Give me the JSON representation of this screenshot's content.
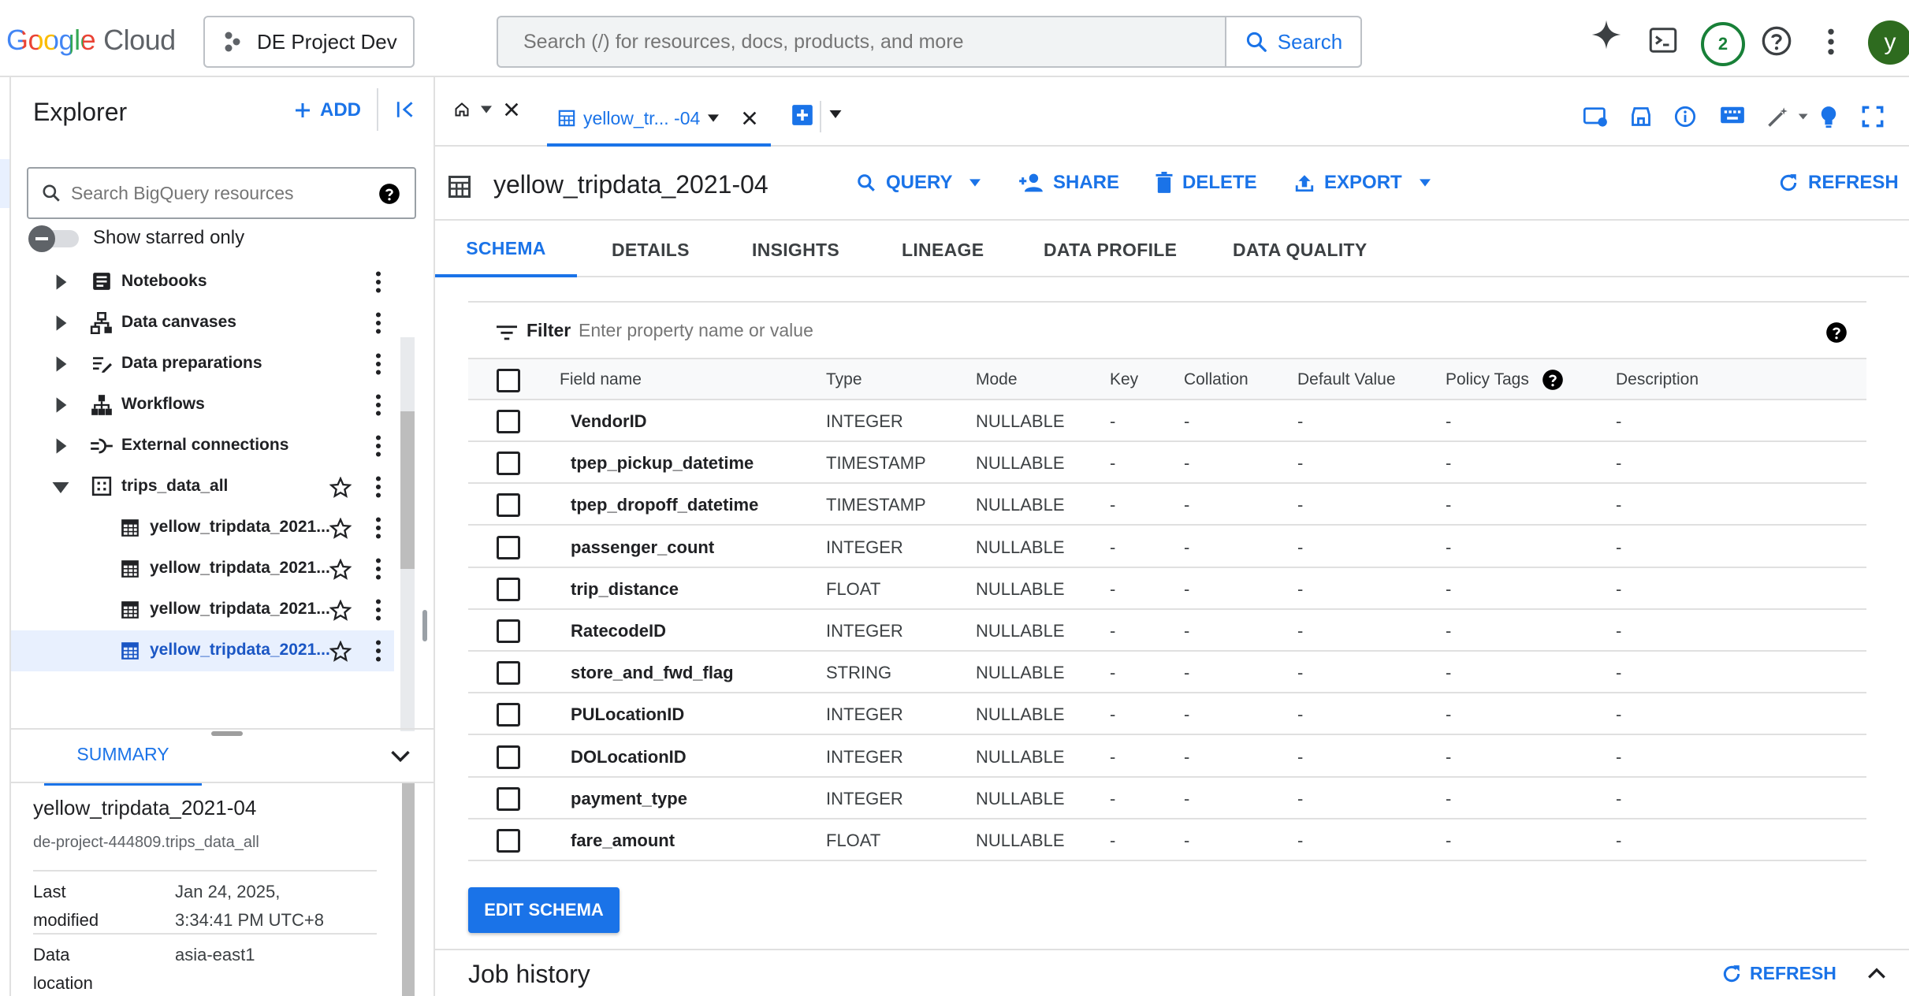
{
  "header": {
    "logo_google": "Google",
    "logo_cloud": "Cloud",
    "project": "DE Project Dev",
    "search_placeholder": "Search (/) for resources, docs, products, and more",
    "search_button": "Search",
    "notification_count": "2",
    "avatar_letter": "y"
  },
  "explorer": {
    "title": "Explorer",
    "add_label": "ADD",
    "search_placeholder": "Search BigQuery resources",
    "starred_label": "Show starred only",
    "items": [
      {
        "label": "Notebooks",
        "icon": "notebook-icon"
      },
      {
        "label": "Data canvases",
        "icon": "canvas-icon"
      },
      {
        "label": "Data preparations",
        "icon": "data-prep-icon"
      },
      {
        "label": "Workflows",
        "icon": "workflow-icon"
      },
      {
        "label": "External connections",
        "icon": "connection-icon"
      },
      {
        "label": "trips_data_all",
        "icon": "dataset-icon"
      },
      {
        "label": "yellow_tripdata_2021...",
        "icon": "table-icon"
      },
      {
        "label": "yellow_tripdata_2021...",
        "icon": "table-icon"
      },
      {
        "label": "yellow_tripdata_2021...",
        "icon": "table-icon"
      },
      {
        "label": "yellow_tripdata_2021...",
        "icon": "table-icon"
      }
    ],
    "summary": {
      "tab": "SUMMARY",
      "table_name": "yellow_tripdata_2021-04",
      "table_path": "de-project-444809.trips_data_all",
      "last_modified_key_1": "Last",
      "last_modified_key_2": "modified",
      "last_modified_value_1": "Jan 24, 2025,",
      "last_modified_value_2": "3:34:41 PM UTC+8",
      "data_location_key_1": "Data",
      "data_location_key_2": "location",
      "data_location_value": "asia-east1"
    }
  },
  "main": {
    "tab_label": "yellow_tr... -04",
    "table_title": "yellow_tripdata_2021-04",
    "actions": {
      "query": "QUERY",
      "share": "SHARE",
      "delete": "DELETE",
      "export": "EXPORT",
      "refresh": "REFRESH"
    },
    "subtabs": [
      "SCHEMA",
      "DETAILS",
      "INSIGHTS",
      "LINEAGE",
      "DATA PROFILE",
      "DATA QUALITY"
    ],
    "filter_label": "Filter",
    "filter_placeholder": "Enter property name or value",
    "columns": [
      "Field name",
      "Type",
      "Mode",
      "Key",
      "Collation",
      "Default Value",
      "Policy Tags",
      "Description"
    ],
    "rows": [
      [
        "VendorID",
        "INTEGER",
        "NULLABLE",
        "-",
        "-",
        "-",
        "-",
        "-"
      ],
      [
        "tpep_pickup_datetime",
        "TIMESTAMP",
        "NULLABLE",
        "-",
        "-",
        "-",
        "-",
        "-"
      ],
      [
        "tpep_dropoff_datetime",
        "TIMESTAMP",
        "NULLABLE",
        "-",
        "-",
        "-",
        "-",
        "-"
      ],
      [
        "passenger_count",
        "INTEGER",
        "NULLABLE",
        "-",
        "-",
        "-",
        "-",
        "-"
      ],
      [
        "trip_distance",
        "FLOAT",
        "NULLABLE",
        "-",
        "-",
        "-",
        "-",
        "-"
      ],
      [
        "RatecodeID",
        "INTEGER",
        "NULLABLE",
        "-",
        "-",
        "-",
        "-",
        "-"
      ],
      [
        "store_and_fwd_flag",
        "STRING",
        "NULLABLE",
        "-",
        "-",
        "-",
        "-",
        "-"
      ],
      [
        "PULocationID",
        "INTEGER",
        "NULLABLE",
        "-",
        "-",
        "-",
        "-",
        "-"
      ],
      [
        "DOLocationID",
        "INTEGER",
        "NULLABLE",
        "-",
        "-",
        "-",
        "-",
        "-"
      ],
      [
        "payment_type",
        "INTEGER",
        "NULLABLE",
        "-",
        "-",
        "-",
        "-",
        "-"
      ],
      [
        "fare_amount",
        "FLOAT",
        "NULLABLE",
        "-",
        "-",
        "-",
        "-",
        "-"
      ]
    ],
    "edit_schema": "EDIT SCHEMA",
    "job_history": "Job history",
    "job_refresh": "REFRESH"
  },
  "colors": {
    "accent": "#1a73e8",
    "badge": "#188038",
    "avatar": "#2e6b1f"
  }
}
